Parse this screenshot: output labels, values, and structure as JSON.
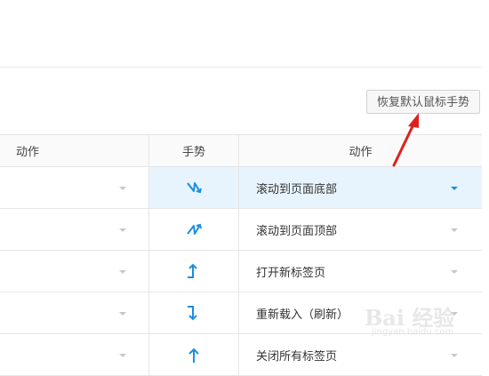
{
  "reset_button": {
    "label": "恢复默认鼠标手势"
  },
  "table": {
    "headers": {
      "action_left": "动作",
      "gesture": "手势",
      "action_right": "动作"
    },
    "rows": [
      {
        "gesture_icon": "zigzag-down-icon",
        "action": "滚动到页面底部",
        "selected": true
      },
      {
        "gesture_icon": "zigzag-up-icon",
        "action": "滚动到页面顶部",
        "selected": false
      },
      {
        "gesture_icon": "right-up-arrow-icon",
        "action": "打开新标签页",
        "selected": false
      },
      {
        "gesture_icon": "right-down-arrow-icon",
        "action": "重新载入（刷新）",
        "selected": false
      },
      {
        "gesture_icon": "up-arrow-icon",
        "action": "关闭所有标签页",
        "selected": false
      }
    ]
  },
  "watermark": {
    "text": "Bai 经验",
    "sub": "jingyan.baidu.com"
  },
  "colors": {
    "accent": "#1a8fe3",
    "annotation": "#e0201b",
    "selected_bg": "#e8f4fd"
  }
}
